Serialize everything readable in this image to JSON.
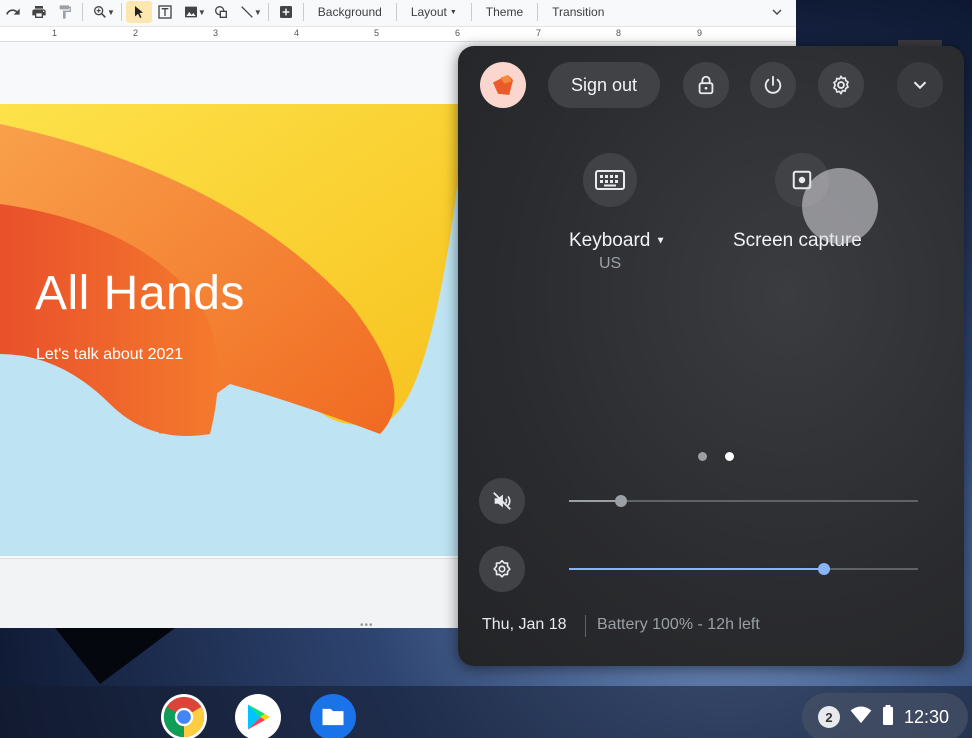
{
  "toolbar": {
    "background_label": "Background",
    "layout_label": "Layout",
    "theme_label": "Theme",
    "transition_label": "Transition",
    "icons": [
      "redo-icon",
      "print-icon",
      "paint-format-icon",
      "zoom-icon",
      "select-icon",
      "text-box-icon",
      "image-icon",
      "shape-icon",
      "line-icon",
      "new-comment-icon",
      "collapse-chevron-icon"
    ]
  },
  "ruler": {
    "numbers": [
      "1",
      "2",
      "3",
      "4",
      "5",
      "6",
      "7",
      "8",
      "9"
    ]
  },
  "slide": {
    "title": "All Hands",
    "subtitle": "Let's talk about 2021",
    "colors": {
      "orange": "#f5792a",
      "yellow": "#fcd52c",
      "sky": "#bde4f4"
    }
  },
  "quick_settings": {
    "sign_out_label": "Sign out",
    "icons": [
      "user-avatar",
      "lock-icon",
      "power-icon",
      "settings-gear-icon",
      "collapse-chevron-icon"
    ],
    "features": [
      {
        "label": "Keyboard",
        "sublabel": "US",
        "icon": "keyboard-icon"
      },
      {
        "label": "Screen capture",
        "icon": "screen-capture-icon"
      }
    ],
    "pages": {
      "count": 2,
      "current": 2
    },
    "volume": {
      "level": 0.15,
      "muted": true,
      "icon": "volume-muted-icon"
    },
    "brightness": {
      "level": 0.73,
      "icon": "brightness-icon"
    },
    "date": "Thu, Jan 18",
    "battery": "Battery 100% - 12h left",
    "accent_color": "#8ab4f8"
  },
  "shelf": {
    "apps": [
      "chrome-app-icon",
      "play-store-app-icon",
      "files-app-icon"
    ],
    "notification_count": "2",
    "time": "12:30",
    "status_icons": [
      "wifi-icon",
      "battery-icon"
    ]
  }
}
